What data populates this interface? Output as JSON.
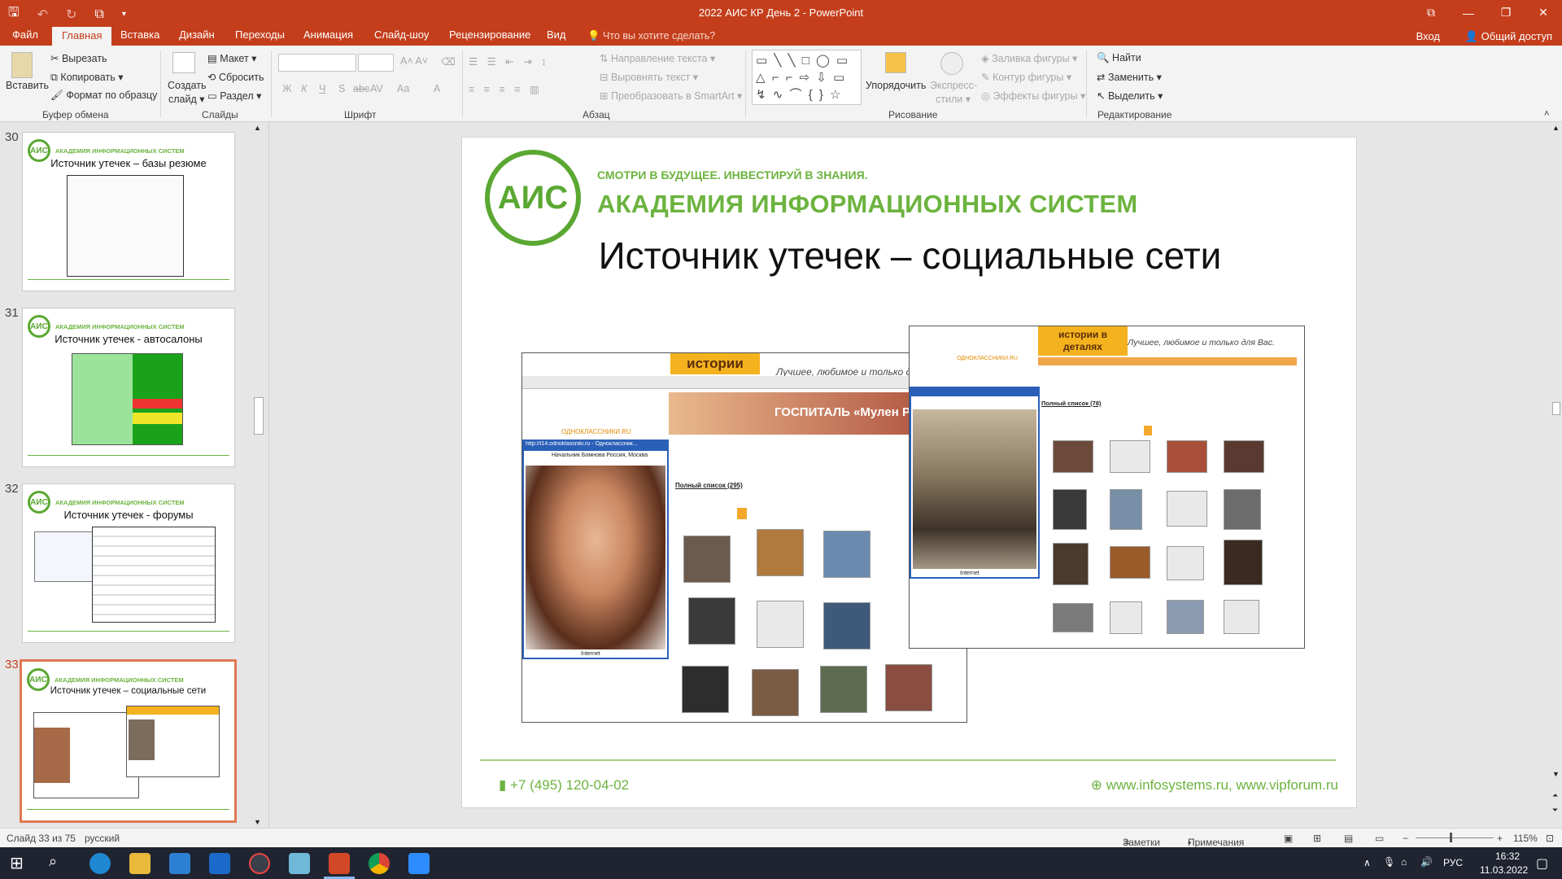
{
  "app": {
    "title": "2022 АИС КР День 2 - PowerPoint",
    "window_controls": [
      "⧉",
      "—",
      "❐",
      "✕"
    ],
    "qat_icons": [
      "save-icon",
      "undo-icon",
      "redo-icon",
      "start-from-beginning-icon",
      "customize-qat-icon"
    ]
  },
  "tabs": [
    {
      "label": "Файл"
    },
    {
      "label": "Главная",
      "active": true
    },
    {
      "label": "Вставка"
    },
    {
      "label": "Дизайн"
    },
    {
      "label": "Переходы"
    },
    {
      "label": "Анимация"
    },
    {
      "label": "Слайд-шоу"
    },
    {
      "label": "Рецензирование"
    },
    {
      "label": "Вид"
    }
  ],
  "tellme": "Что вы хотите сделать?",
  "signin": "Вход",
  "share": "Общий доступ",
  "ribbon": {
    "clipboard": {
      "paste": "Вставить",
      "cut": "Вырезать",
      "copy": "Копировать",
      "format_painter": "Формат по образцу",
      "label": "Буфер обмена"
    },
    "slides": {
      "new_slide_line1": "Создать",
      "new_slide_line2": "слайд",
      "layout": "Макет",
      "reset": "Сбросить",
      "section": "Раздел",
      "label": "Слайды"
    },
    "font": {
      "label": "Шрифт",
      "bold": "Ж",
      "italic": "К",
      "underline": "Ч",
      "shadow": "S",
      "strike": "abc",
      "spacing": "AV",
      "case": "Aa",
      "color": "A"
    },
    "paragraph": {
      "label": "Абзац",
      "text_direction": "Направление текста",
      "align_text": "Выровнять текст",
      "smartart": "Преобразовать в SmartArt"
    },
    "drawing": {
      "label": "Рисование",
      "arrange": "Упорядочить",
      "quick_styles_line1": "Экспресс-",
      "quick_styles_line2": "стили",
      "shape_fill": "Заливка фигуры",
      "shape_outline": "Контур фигуры",
      "shape_effects": "Эффекты фигуры",
      "shapes_glyphs": "▭ ╲ ╲ □ ◯ ▭ △ ⌐ ⌐ ⇨ ⇩ ▭ ↯ ∿ ⌒ { } ☆"
    },
    "editing": {
      "label": "Редактирование",
      "find": "Найти",
      "replace": "Заменить",
      "select": "Выделить"
    }
  },
  "thumbnails": [
    {
      "num": "30",
      "title": "Источник утечек – базы резюме",
      "subtitle": "АКАДЕМИЯ ИНФОРМАЦИОННЫХ СИСТЕМ"
    },
    {
      "num": "31",
      "title": "Источник утечек - автосалоны",
      "subtitle": "АКАДЕМИЯ ИНФОРМАЦИОННЫХ СИСТЕМ"
    },
    {
      "num": "32",
      "title": "Источник утечек - форумы",
      "subtitle": "АКАДЕМИЯ ИНФОРМАЦИОННЫХ СИСТЕМ"
    },
    {
      "num": "33",
      "title": "Источник утечек – социальные сети",
      "subtitle": "АКАДЕМИЯ ИНФОРМАЦИОННЫХ СИСТЕМ",
      "active": true
    }
  ],
  "slide": {
    "logo_text": "АИС",
    "slogan": "СМОТРИ В БУДУЩЕЕ. ИНВЕСТИРУЙ В ЗНАНИЯ.",
    "academy": "АКАДЕМИЯ ИНФОРМАЦИОННЫХ СИСТЕМ",
    "title": "Источник утечек – социальные сети",
    "phone": "+7 (495) 120-04-02",
    "urls": "www.infosystems.ru, www.vipforum.ru",
    "shot1": {
      "banner": "истории",
      "tagline": "Лучшее, любимое и только д",
      "site_label": "ОДНОКЛАССНИКИ.RU",
      "hospital_banner": "ГОСПИТАЛЬ «Мулен Руж»",
      "popup_url": "http://t14.odnoklassniki.ru - Одноклассник...",
      "name_line": "Начальник Бомнова Россия, Москва",
      "list_title": "Полный список (295)",
      "internet": "Internet"
    },
    "shot2": {
      "banner": "истории в деталях",
      "tagline": "Лучшее, любимое и только для Вас.",
      "site_label": "ОДНОКЛАССНИКИ.RU",
      "list_title": "Полный список (78)",
      "internet": "Internet"
    }
  },
  "statusbar": {
    "slide_counter": "Слайд 33 из 75",
    "language": "русский",
    "notes": "Заметки",
    "comments": "Примечания",
    "zoom": "115%"
  },
  "taskbar": {
    "lang": "РУС",
    "time": "16:32",
    "date": "11.03.2022",
    "tray_arrow": "∧"
  }
}
